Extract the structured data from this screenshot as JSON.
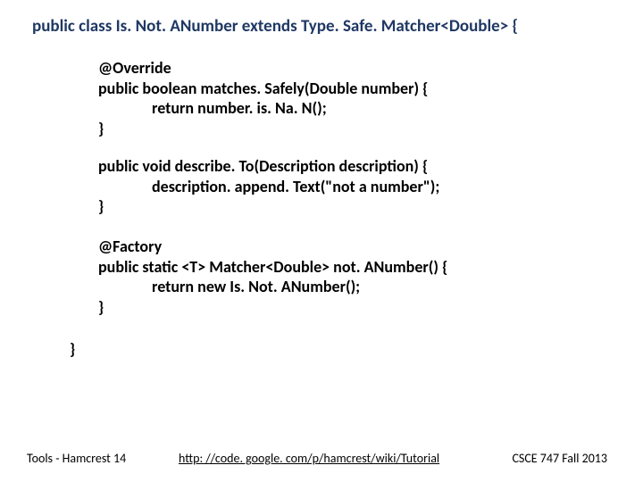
{
  "class_decl": "public class Is. Not. ANumber extends Type. Safe. Matcher<Double> {",
  "block1": {
    "l1": "@Override",
    "l2": "public boolean matches. Safely(Double number) {",
    "l3": "return number. is. Na. N();",
    "l4": "}"
  },
  "block2": {
    "l1": "public void describe. To(Description description) {",
    "l2": "description. append. Text(\"not a number\");",
    "l3": "}"
  },
  "block3": {
    "l1": "@Factory",
    "l2": "public static <T> Matcher<Double> not. ANumber() {",
    "l3": "return new Is. Not. ANumber();",
    "l4": "}"
  },
  "closing": "}",
  "footer": {
    "left": "Tools - Hamcrest  14",
    "center": "http: //code. google. com/p/hamcrest/wiki/Tutorial",
    "right": "CSCE 747 Fall 2013"
  }
}
